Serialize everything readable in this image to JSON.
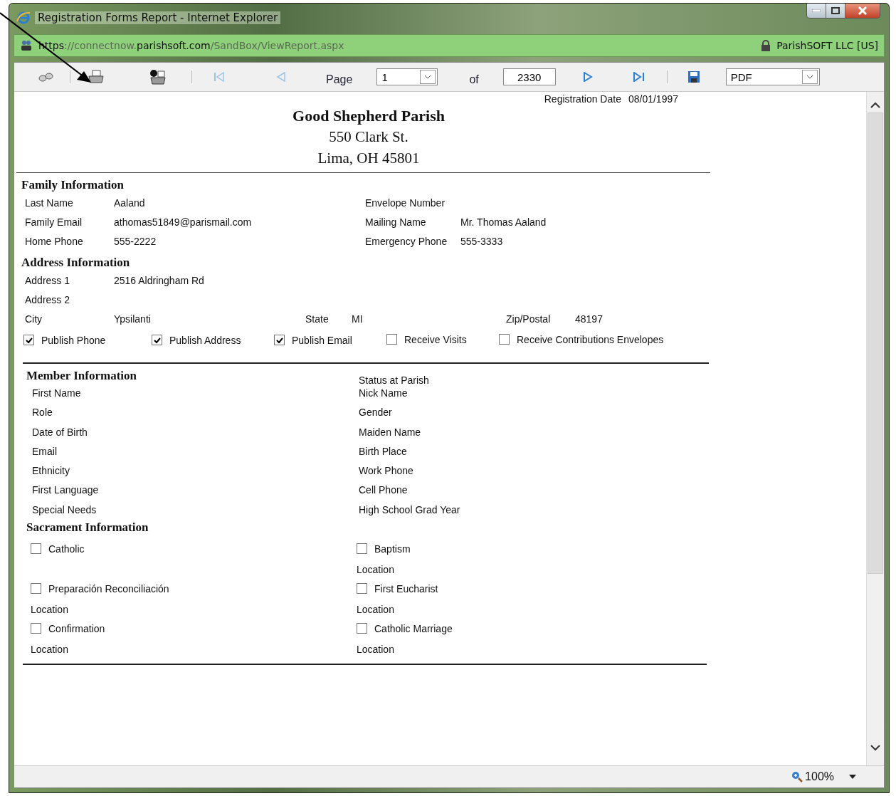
{
  "window": {
    "title": "Registration Forms Report - Internet Explorer",
    "url_parts": [
      {
        "text": "https",
        "emphasized": true
      },
      {
        "text": "://connectnow.",
        "emphasized": false
      },
      {
        "text": "parishsoft.com",
        "emphasized": true
      },
      {
        "text": "/SandBox/ViewReport.aspx",
        "emphasized": false
      }
    ],
    "certificate": "ParishSOFT LLC [US]"
  },
  "toolbar": {
    "page_label": "Page",
    "page_value": "1",
    "of_label": "of",
    "page_count": "2330",
    "export_format": "PDF"
  },
  "report": {
    "registration_date_label": "Registration Date",
    "registration_date": "08/01/1997",
    "parish": {
      "name": "Good Shepherd Parish",
      "street": "550 Clark St.",
      "city": "Lima, OH 45801"
    },
    "family": {
      "heading": "Family Information",
      "rows": [
        {
          "left": {
            "label": "Last Name",
            "value": "Aaland"
          },
          "right": {
            "label": "Envelope Number"
          }
        },
        {
          "left": {
            "label": "Family Email",
            "value": "athomas51849@parismail.com"
          },
          "right": {
            "label": "Mailing Name",
            "value": "Mr. Thomas Aaland"
          }
        },
        {
          "left": {
            "label": "Home Phone",
            "value": "555-2222"
          },
          "right": {
            "label": "Emergency Phone",
            "value": "555-3333"
          }
        }
      ]
    },
    "address": {
      "heading": "Address Information",
      "lines": [
        {
          "label": "Address 1",
          "value": "2516 Aldringham Rd"
        },
        {
          "label": "Address 2"
        }
      ],
      "city": {
        "label": "City",
        "value": "Ypsilanti"
      },
      "state": {
        "label": "State",
        "value": "MI"
      },
      "zip": {
        "label": "Zip/Postal",
        "value": "48197"
      },
      "options": [
        {
          "label": "Publish Phone",
          "checked": true
        },
        {
          "label": "Publish Address",
          "checked": true
        },
        {
          "label": "Publish Email",
          "checked": true
        },
        {
          "label": "Receive Visits",
          "checked": false
        },
        {
          "label": "Receive Contributions Envelopes",
          "checked": false
        }
      ]
    },
    "member": {
      "heading": "Member Information",
      "status_label": "Status at Parish",
      "left": [
        "First Name",
        "Role",
        "Date of Birth",
        "Email",
        "Ethnicity",
        "First Language",
        "Special Needs"
      ],
      "right": [
        "Nick Name",
        "Gender",
        "Maiden Name",
        "Birth Place",
        "Work Phone",
        "Cell Phone",
        "High School Grad Year"
      ]
    },
    "sacrament": {
      "heading": "Sacrament Information",
      "rows": [
        {
          "left": {
            "kind": "checkbox",
            "label": "Catholic",
            "checked": false
          },
          "right": {
            "kind": "checkbox",
            "label": "Baptism",
            "checked": false
          }
        },
        {
          "right": {
            "kind": "label",
            "label": "Location"
          }
        },
        {
          "left": {
            "kind": "checkbox",
            "label": "Preparación Reconciliación",
            "checked": false
          },
          "right": {
            "kind": "checkbox",
            "label": "First Eucharist",
            "checked": false
          }
        },
        {
          "left": {
            "kind": "label",
            "label": "Location"
          },
          "right": {
            "kind": "label",
            "label": "Location"
          }
        },
        {
          "left": {
            "kind": "checkbox",
            "label": "Confirmation",
            "checked": false
          },
          "right": {
            "kind": "checkbox",
            "label": "Catholic Marriage",
            "checked": false
          }
        },
        {
          "left": {
            "kind": "label",
            "label": "Location"
          },
          "right": {
            "kind": "label",
            "label": "Location"
          }
        }
      ]
    }
  },
  "status_bar": {
    "zoom": "100%"
  }
}
